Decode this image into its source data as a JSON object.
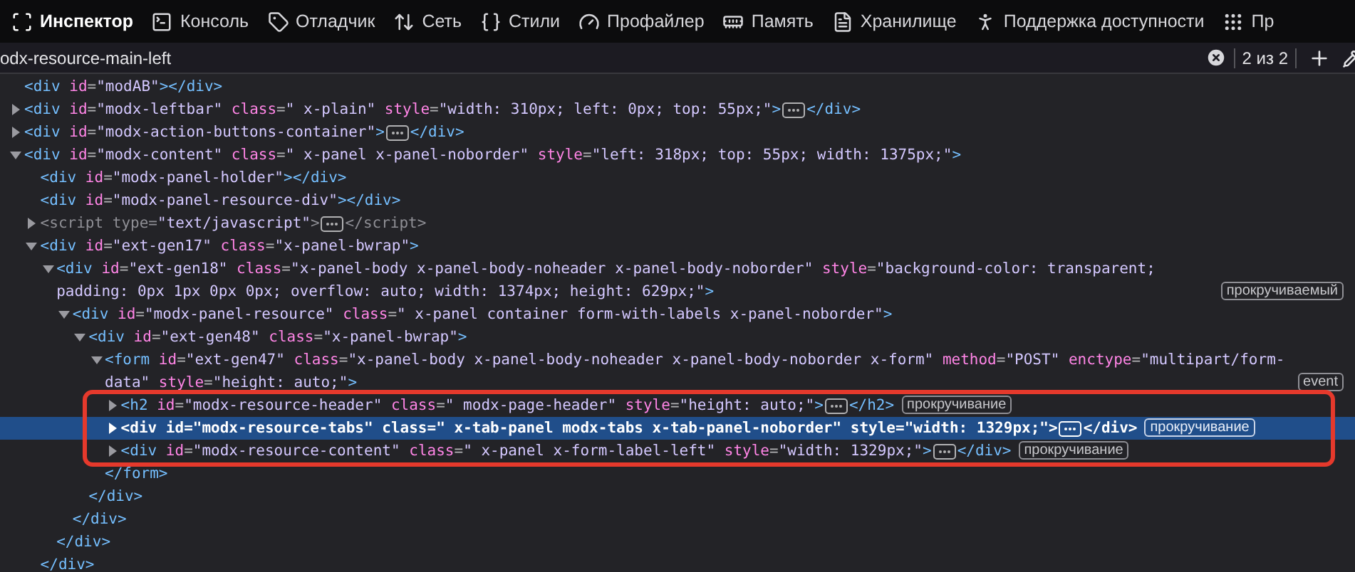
{
  "toolbar": {
    "tabs": [
      {
        "label": "Инспектор",
        "selected": true
      },
      {
        "label": "Консоль",
        "selected": false
      },
      {
        "label": "Отладчик",
        "selected": false
      },
      {
        "label": "Сеть",
        "selected": false
      },
      {
        "label": "Стили",
        "selected": false
      },
      {
        "label": "Профайлер",
        "selected": false
      },
      {
        "label": "Память",
        "selected": false
      },
      {
        "label": "Хранилище",
        "selected": false
      },
      {
        "label": "Поддержка доступности",
        "selected": false
      },
      {
        "label": "Пр",
        "selected": false
      }
    ]
  },
  "search": {
    "value": "odx-resource-main-left",
    "count": "2 из 2"
  },
  "tree": [
    {
      "kind": "leaf",
      "selected": false,
      "outlined": false,
      "segs": [
        {
          "kind": "tag",
          "text": "<div"
        },
        {
          "kind": "attr",
          "text": " id"
        },
        {
          "kind": "punct",
          "text": "="
        },
        {
          "kind": "value",
          "text": "\"modAB\""
        },
        {
          "kind": "tag",
          "text": "></div>"
        }
      ]
    },
    {
      "kind": "parent",
      "expanded": false,
      "selected": false,
      "outlined": false,
      "segs": [
        {
          "kind": "tag",
          "text": "<div"
        },
        {
          "kind": "attr",
          "text": " id"
        },
        {
          "kind": "punct",
          "text": "="
        },
        {
          "kind": "value",
          "text": "\"modx-leftbar\""
        },
        {
          "kind": "attr",
          "text": " class"
        },
        {
          "kind": "punct",
          "text": "="
        },
        {
          "kind": "value",
          "text": "\" x-plain\""
        },
        {
          "kind": "attr",
          "text": " style"
        },
        {
          "kind": "punct",
          "text": "="
        },
        {
          "kind": "value",
          "text": "\"width: 310px; left: 0px; top: 55px;\""
        },
        {
          "kind": "tag",
          "text": ">"
        },
        {
          "kind": "more"
        },
        {
          "kind": "tag",
          "text": "</div>"
        }
      ]
    },
    {
      "kind": "parent",
      "expanded": false,
      "selected": false,
      "outlined": false,
      "segs": [
        {
          "kind": "tag",
          "text": "<div"
        },
        {
          "kind": "attr",
          "text": " id"
        },
        {
          "kind": "punct",
          "text": "="
        },
        {
          "kind": "value",
          "text": "\"modx-action-buttons-container\""
        },
        {
          "kind": "tag",
          "text": ">"
        },
        {
          "kind": "more"
        },
        {
          "kind": "tag",
          "text": "</div>"
        }
      ]
    },
    {
      "kind": "parent",
      "expanded": true,
      "selected": false,
      "outlined": false,
      "segs": [
        {
          "kind": "tag",
          "text": "<div"
        },
        {
          "kind": "attr",
          "text": " id"
        },
        {
          "kind": "punct",
          "text": "="
        },
        {
          "kind": "value",
          "text": "\"modx-content\""
        },
        {
          "kind": "attr",
          "text": " class"
        },
        {
          "kind": "punct",
          "text": "="
        },
        {
          "kind": "value",
          "text": "\" x-panel x-panel-noborder\""
        },
        {
          "kind": "attr",
          "text": " style"
        },
        {
          "kind": "punct",
          "text": "="
        },
        {
          "kind": "value",
          "text": "\"left: 318px; top: 55px; width: 1375px;\""
        },
        {
          "kind": "tag",
          "text": ">"
        }
      ],
      "children": [
        {
          "kind": "leaf",
          "selected": false,
          "outlined": false,
          "segs": [
            {
              "kind": "tag",
              "text": "<div"
            },
            {
              "kind": "attr",
              "text": " id"
            },
            {
              "kind": "punct",
              "text": "="
            },
            {
              "kind": "value",
              "text": "\"modx-panel-holder\""
            },
            {
              "kind": "tag",
              "text": "></div>"
            }
          ]
        },
        {
          "kind": "leaf",
          "selected": false,
          "outlined": false,
          "segs": [
            {
              "kind": "tag",
              "text": "<div"
            },
            {
              "kind": "attr",
              "text": " id"
            },
            {
              "kind": "punct",
              "text": "="
            },
            {
              "kind": "value",
              "text": "\"modx-panel-resource-div\""
            },
            {
              "kind": "tag",
              "text": "></div>"
            }
          ]
        },
        {
          "kind": "parent",
          "expanded": false,
          "dimmed": true,
          "selected": false,
          "outlined": false,
          "segs": [
            {
              "kind": "tag",
              "text": "<script"
            },
            {
              "kind": "attr",
              "text": " type"
            },
            {
              "kind": "punct",
              "text": "="
            },
            {
              "kind": "value",
              "text": "\"text/javascript\""
            },
            {
              "kind": "tag",
              "text": ">"
            },
            {
              "kind": "more"
            },
            {
              "kind": "tag",
              "text": "</script>"
            }
          ]
        },
        {
          "kind": "parent",
          "expanded": true,
          "selected": false,
          "outlined": false,
          "segs": [
            {
              "kind": "tag",
              "text": "<div"
            },
            {
              "kind": "attr",
              "text": " id"
            },
            {
              "kind": "punct",
              "text": "="
            },
            {
              "kind": "value",
              "text": "\"ext-gen17\""
            },
            {
              "kind": "attr",
              "text": " class"
            },
            {
              "kind": "punct",
              "text": "="
            },
            {
              "kind": "value",
              "text": "\"x-panel-bwrap\""
            },
            {
              "kind": "tag",
              "text": ">"
            }
          ],
          "close": [
            {
              "kind": "tag",
              "text": "</div>"
            }
          ],
          "children": [
            {
              "kind": "parent",
              "expanded": true,
              "selected": false,
              "outlined": false,
              "badges": [
                "прокручиваемый"
              ],
              "segs": [
                {
                  "kind": "tag",
                  "text": "<div"
                },
                {
                  "kind": "attr",
                  "text": " id"
                },
                {
                  "kind": "punct",
                  "text": "="
                },
                {
                  "kind": "value",
                  "text": "\"ext-gen18\""
                },
                {
                  "kind": "attr",
                  "text": " class"
                },
                {
                  "kind": "punct",
                  "text": "="
                },
                {
                  "kind": "value",
                  "text": "\"x-panel-body x-panel-body-noheader x-panel-body-noborder\""
                },
                {
                  "kind": "attr",
                  "text": " style"
                },
                {
                  "kind": "punct",
                  "text": "="
                },
                {
                  "kind": "value",
                  "text": "\"background-color: transparent; padding: 0px 1px 0px 0px; overflow: auto; width: 1374px; height: 629px;\""
                },
                {
                  "kind": "tag",
                  "text": ">"
                }
              ],
              "close": [
                {
                  "kind": "tag",
                  "text": "</div>"
                }
              ],
              "children": [
                {
                  "kind": "parent",
                  "expanded": true,
                  "selected": false,
                  "outlined": false,
                  "segs": [
                    {
                      "kind": "tag",
                      "text": "<div"
                    },
                    {
                      "kind": "attr",
                      "text": " id"
                    },
                    {
                      "kind": "punct",
                      "text": "="
                    },
                    {
                      "kind": "value",
                      "text": "\"modx-panel-resource\""
                    },
                    {
                      "kind": "attr",
                      "text": " class"
                    },
                    {
                      "kind": "punct",
                      "text": "="
                    },
                    {
                      "kind": "value",
                      "text": "\" x-panel container form-with-labels x-panel-noborder\""
                    },
                    {
                      "kind": "tag",
                      "text": ">"
                    }
                  ],
                  "close": [
                    {
                      "kind": "tag",
                      "text": "</div>"
                    }
                  ],
                  "children": [
                    {
                      "kind": "parent",
                      "expanded": true,
                      "selected": false,
                      "outlined": false,
                      "segs": [
                        {
                          "kind": "tag",
                          "text": "<div"
                        },
                        {
                          "kind": "attr",
                          "text": " id"
                        },
                        {
                          "kind": "punct",
                          "text": "="
                        },
                        {
                          "kind": "value",
                          "text": "\"ext-gen48\""
                        },
                        {
                          "kind": "attr",
                          "text": " class"
                        },
                        {
                          "kind": "punct",
                          "text": "="
                        },
                        {
                          "kind": "value",
                          "text": "\"x-panel-bwrap\""
                        },
                        {
                          "kind": "tag",
                          "text": ">"
                        }
                      ],
                      "close": [
                        {
                          "kind": "tag",
                          "text": "</div>"
                        }
                      ],
                      "children": [
                        {
                          "kind": "parent",
                          "expanded": true,
                          "selected": false,
                          "outlined": false,
                          "badges": [
                            "event"
                          ],
                          "segs": [
                            {
                              "kind": "tag",
                              "text": "<form"
                            },
                            {
                              "kind": "attr",
                              "text": " id"
                            },
                            {
                              "kind": "punct",
                              "text": "="
                            },
                            {
                              "kind": "value",
                              "text": "\"ext-gen47\""
                            },
                            {
                              "kind": "attr",
                              "text": " class"
                            },
                            {
                              "kind": "punct",
                              "text": "="
                            },
                            {
                              "kind": "value",
                              "text": "\"x-panel-body x-panel-body-noheader x-panel-body-noborder x-form\""
                            },
                            {
                              "kind": "attr",
                              "text": " method"
                            },
                            {
                              "kind": "punct",
                              "text": "="
                            },
                            {
                              "kind": "value",
                              "text": "\"POST\""
                            },
                            {
                              "kind": "attr",
                              "text": " enctype"
                            },
                            {
                              "kind": "punct",
                              "text": "="
                            },
                            {
                              "kind": "value",
                              "text": "\"multipart/form-data\""
                            },
                            {
                              "kind": "attr",
                              "text": " style"
                            },
                            {
                              "kind": "punct",
                              "text": "="
                            },
                            {
                              "kind": "value",
                              "text": "\"height: auto;\""
                            },
                            {
                              "kind": "tag",
                              "text": ">"
                            }
                          ],
                          "close": [
                            {
                              "kind": "tag",
                              "text": "</form>"
                            }
                          ],
                          "children": [
                            {
                              "kind": "parent",
                              "expanded": false,
                              "selected": false,
                              "outlined": true,
                              "badges": [
                                "прокручивание"
                              ],
                              "segs": [
                                {
                                  "kind": "tag",
                                  "text": "<h2"
                                },
                                {
                                  "kind": "attr",
                                  "text": " id"
                                },
                                {
                                  "kind": "punct",
                                  "text": "="
                                },
                                {
                                  "kind": "value",
                                  "text": "\"modx-resource-header\""
                                },
                                {
                                  "kind": "attr",
                                  "text": " class"
                                },
                                {
                                  "kind": "punct",
                                  "text": "="
                                },
                                {
                                  "kind": "value",
                                  "text": "\" modx-page-header\""
                                },
                                {
                                  "kind": "attr",
                                  "text": " style"
                                },
                                {
                                  "kind": "punct",
                                  "text": "="
                                },
                                {
                                  "kind": "value",
                                  "text": "\"height: auto;\""
                                },
                                {
                                  "kind": "tag",
                                  "text": ">"
                                },
                                {
                                  "kind": "more"
                                },
                                {
                                  "kind": "tag",
                                  "text": "</h2>"
                                }
                              ]
                            },
                            {
                              "kind": "parent",
                              "expanded": false,
                              "selected": true,
                              "outlined": true,
                              "badges": [
                                "прокручивание"
                              ],
                              "segs": [
                                {
                                  "kind": "tag",
                                  "text": "<div"
                                },
                                {
                                  "kind": "attr",
                                  "text": " id"
                                },
                                {
                                  "kind": "punct",
                                  "text": "="
                                },
                                {
                                  "kind": "value",
                                  "text": "\"modx-resource-tabs\""
                                },
                                {
                                  "kind": "attr",
                                  "text": " class"
                                },
                                {
                                  "kind": "punct",
                                  "text": "="
                                },
                                {
                                  "kind": "value",
                                  "text": "\" x-tab-panel modx-tabs x-tab-panel-noborder\""
                                },
                                {
                                  "kind": "attr",
                                  "text": " style"
                                },
                                {
                                  "kind": "punct",
                                  "text": "="
                                },
                                {
                                  "kind": "value",
                                  "text": "\"width: 1329px;\""
                                },
                                {
                                  "kind": "tag",
                                  "text": ">"
                                },
                                {
                                  "kind": "more"
                                },
                                {
                                  "kind": "tag",
                                  "text": "</div>"
                                }
                              ]
                            },
                            {
                              "kind": "parent",
                              "expanded": false,
                              "selected": false,
                              "outlined": true,
                              "badges": [
                                "прокручивание"
                              ],
                              "segs": [
                                {
                                  "kind": "tag",
                                  "text": "<div"
                                },
                                {
                                  "kind": "attr",
                                  "text": " id"
                                },
                                {
                                  "kind": "punct",
                                  "text": "="
                                },
                                {
                                  "kind": "value",
                                  "text": "\"modx-resource-content\""
                                },
                                {
                                  "kind": "attr",
                                  "text": " class"
                                },
                                {
                                  "kind": "punct",
                                  "text": "="
                                },
                                {
                                  "kind": "value",
                                  "text": "\" x-panel x-form-label-left\""
                                },
                                {
                                  "kind": "attr",
                                  "text": " style"
                                },
                                {
                                  "kind": "punct",
                                  "text": "="
                                },
                                {
                                  "kind": "value",
                                  "text": "\"width: 1329px;\""
                                },
                                {
                                  "kind": "tag",
                                  "text": ">"
                                },
                                {
                                  "kind": "more"
                                },
                                {
                                  "kind": "tag",
                                  "text": "</div>"
                                }
                              ]
                            }
                          ]
                        }
                      ]
                    }
                  ]
                }
              ]
            }
          ]
        }
      ]
    }
  ]
}
